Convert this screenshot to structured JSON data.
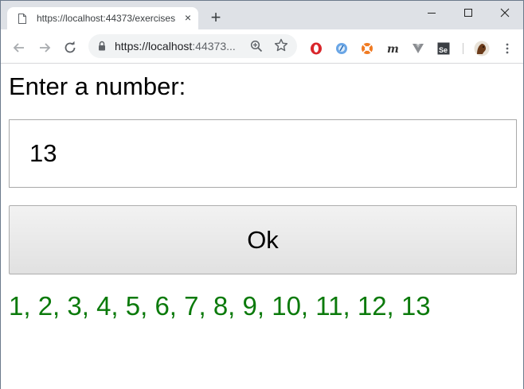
{
  "browser": {
    "tab_title": "https://localhost:44373/exercises",
    "new_tab_symbol": "+",
    "close_tab_symbol": "×",
    "url_host": "https://localhost",
    "url_rest": ":44373...",
    "extensions": [
      "opera-icon",
      "blue-circle-icon",
      "orange-lifebuoy-icon",
      "m-icon",
      "vue-icon",
      "selenium-icon",
      "avatar-icon"
    ]
  },
  "page": {
    "prompt_label": "Enter a number:",
    "number_input_value": "13",
    "ok_button_label": "Ok",
    "result_text": "1, 2, 3, 4, 5, 6, 7, 8, 9, 10, 11, 12, 13"
  },
  "colors": {
    "result_green": "#0b7a0b",
    "tabstrip_bg": "#dee1e6"
  }
}
